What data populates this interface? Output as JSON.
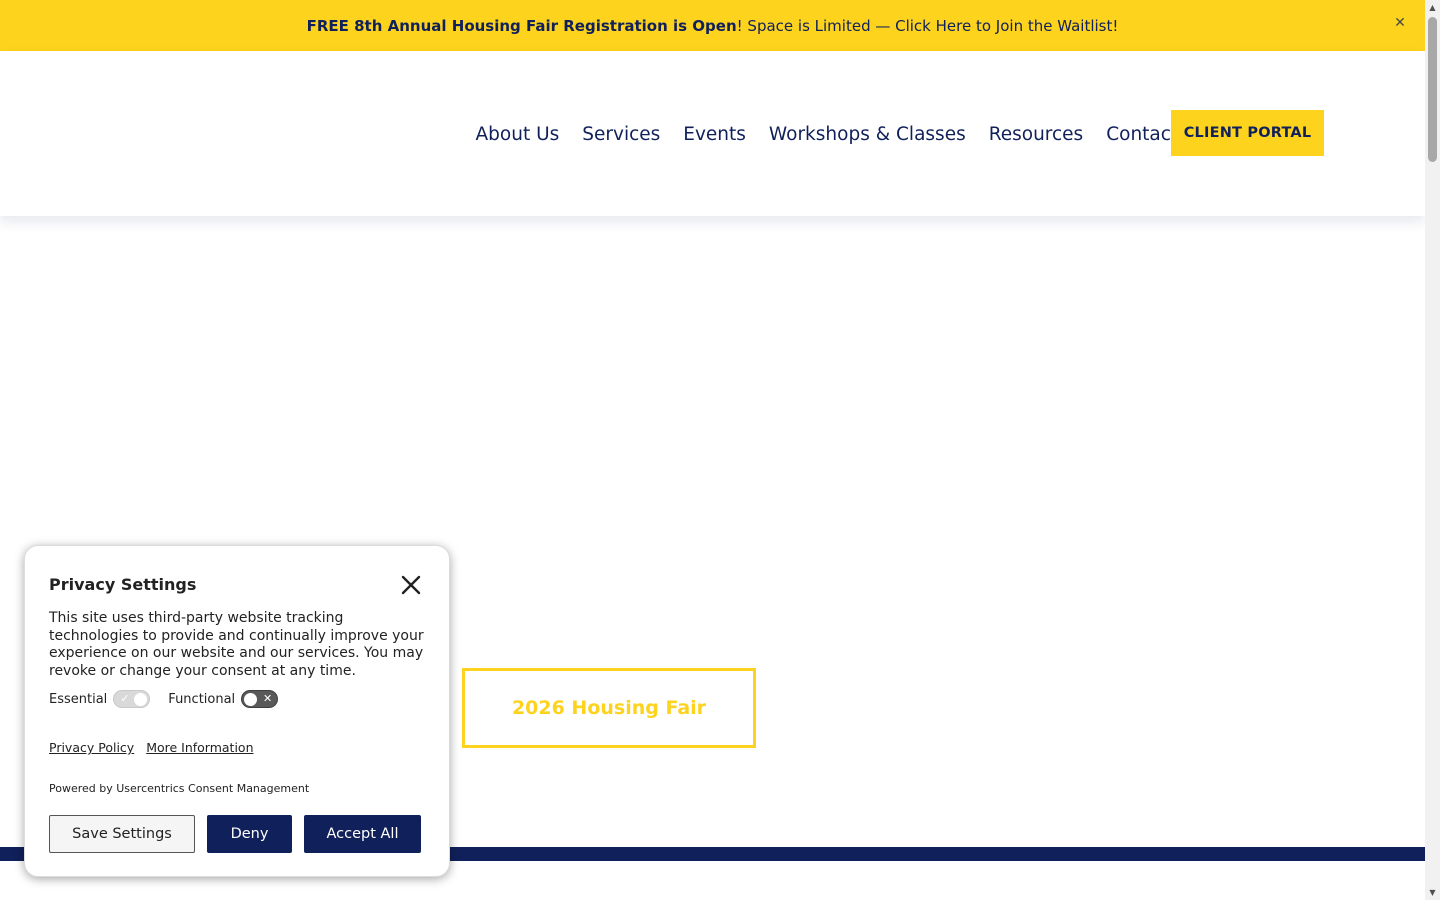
{
  "announcement": {
    "bold_text": "FREE 8th Annual Housing Fair Registration is Open",
    "rest_text": "! Space is Limited — Click Here to Join the Waitlist!",
    "close_glyph": "✕"
  },
  "nav": {
    "items": [
      {
        "label": "About Us"
      },
      {
        "label": "Services"
      },
      {
        "label": "Events"
      },
      {
        "label": "Workshops & Classes"
      },
      {
        "label": "Resources"
      },
      {
        "label": "Contact"
      }
    ],
    "cta_label": "CLIENT PORTAL"
  },
  "main": {
    "fair_button_label": "2026 Housing Fair"
  },
  "privacy": {
    "title": "Privacy Settings",
    "body": "This site uses third-party website tracking technologies to provide and continually improve your experience on our website and our services. You may revoke or change your consent at any time.",
    "toggles": [
      {
        "label": "Essential",
        "state": "on"
      },
      {
        "label": "Functional",
        "state": "off"
      }
    ],
    "links": [
      "Privacy Policy",
      "More Information"
    ],
    "powered_by": "Powered by Usercentrics Consent Management",
    "buttons": {
      "save": "Save Settings",
      "deny": "Deny",
      "accept": "Accept All"
    }
  },
  "colors": {
    "brand_yellow": "#fdd31d",
    "brand_navy": "#10205a"
  }
}
